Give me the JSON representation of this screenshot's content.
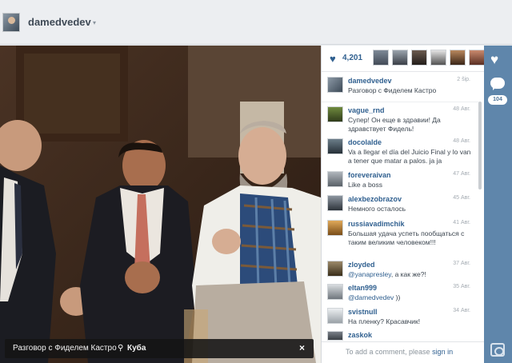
{
  "header": {
    "username": "damedvedev",
    "caret": "▾"
  },
  "photo": {
    "caption": "Разговор с Фиделем Кастро",
    "place": "Куба",
    "close": "×"
  },
  "likes": {
    "count": "4,201"
  },
  "comments": [
    {
      "user": "damedvedev",
      "time": "2 ŝip.",
      "text": "Разговор с Фиделем Кастро"
    },
    {
      "user": "vague_rnd",
      "time": "48 Авг.",
      "text": "Супер! Он еще в здравии! Да здравствует Фидель!"
    },
    {
      "user": "docolalde",
      "time": "48 Авг.",
      "text": "Va a llegar el día del Juicio Final y lo van a tener que matar a palos. ja ja"
    },
    {
      "user": "foreveraivan",
      "time": "47 Авг.",
      "text": "Like a boss"
    },
    {
      "user": "alexbezobrazov",
      "time": "45 Авг.",
      "text": "Немного осталось"
    },
    {
      "user": "russiavadimchik",
      "time": "41 Авг.",
      "text": "Большая удача успеть пообщаться с таким великим человеком!!!"
    },
    {
      "user": "zloyded",
      "time": "37 Авг.",
      "mention": "@yanapresley",
      "text": ", а как же?!"
    },
    {
      "user": "eltan999",
      "time": "35 Авг.",
      "mention": "@damedvedev",
      "text": " ))"
    },
    {
      "user": "svistnull",
      "time": "34 Авг.",
      "text": "На пленку? Красавчик!"
    },
    {
      "user": "zaskok",
      "time": "",
      "text": ""
    }
  ],
  "add_comment": {
    "prompt": "To add a comment, please ",
    "signin": "sign in"
  },
  "rail": {
    "comment_count": "104"
  },
  "colors": {
    "accent": "#2f5f8f",
    "rail": "#5f86ab",
    "page": "#e9ecef"
  },
  "icons": [
    "heart-icon",
    "pin-icon",
    "close-icon",
    "comment-bubble-icon",
    "camera-icon"
  ]
}
